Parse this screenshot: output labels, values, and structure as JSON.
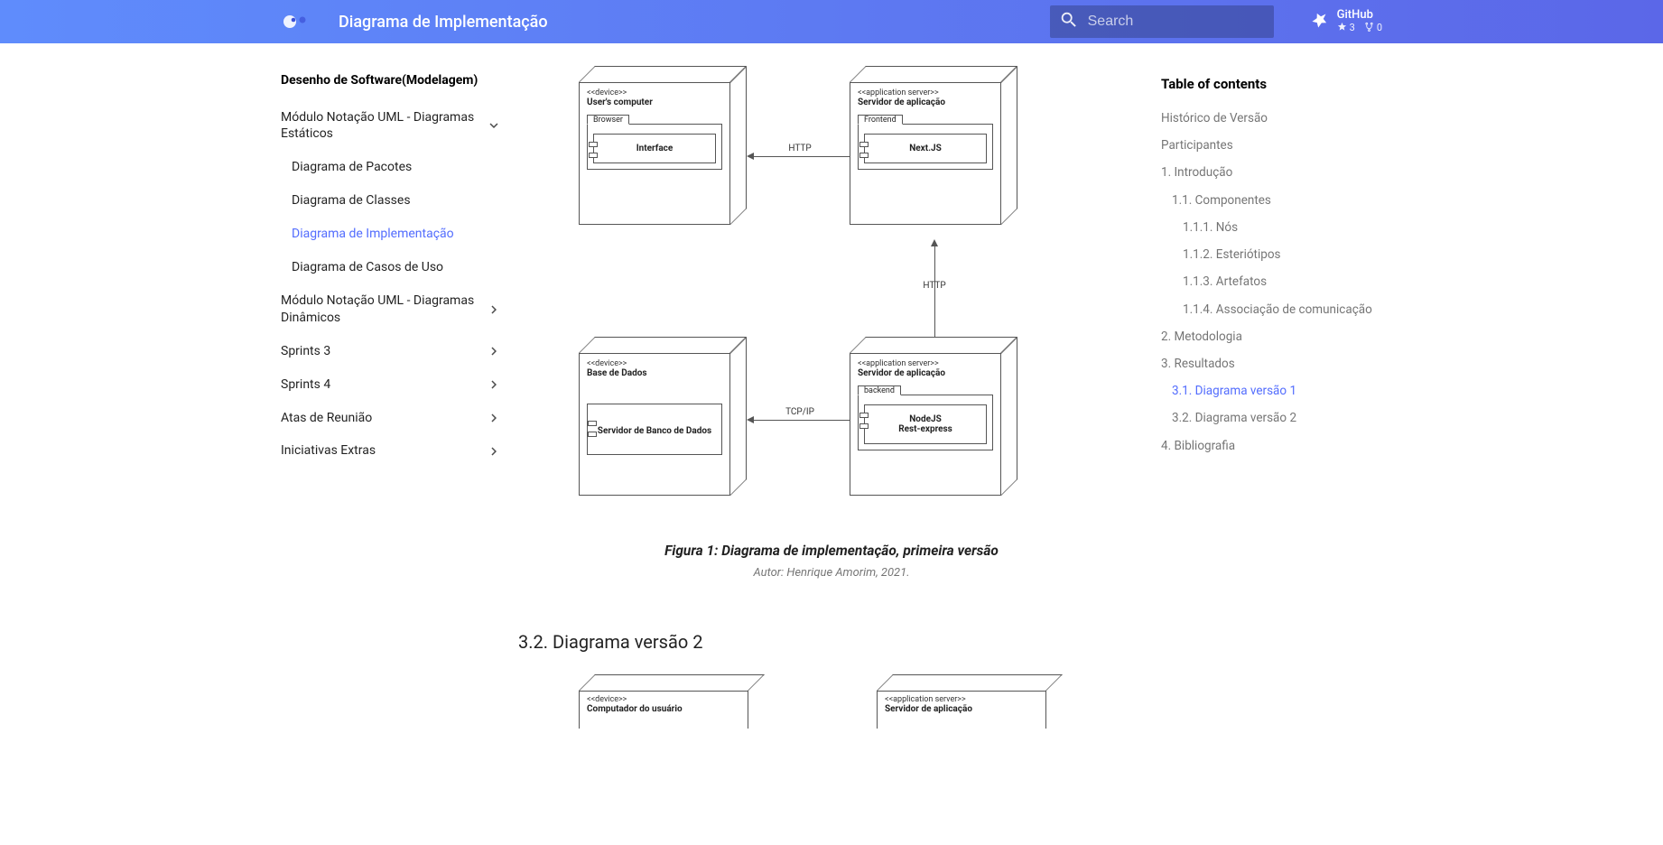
{
  "header": {
    "title": "Diagrama de Implementação",
    "search_placeholder": "Search",
    "github": {
      "name": "GitHub",
      "stars": "3",
      "forks": "0"
    }
  },
  "sidebar": {
    "active_section": "Desenho de Software(Modelagem)",
    "groups": [
      {
        "label": "Módulo Notação UML - Diagramas Estáticos",
        "expanded": true,
        "children": [
          {
            "label": "Diagrama de Pacotes",
            "active": false
          },
          {
            "label": "Diagrama de Classes",
            "active": false
          },
          {
            "label": "Diagrama de Implementação",
            "active": true
          },
          {
            "label": "Diagrama de Casos de Uso",
            "active": false
          }
        ]
      },
      {
        "label": "Módulo Notação UML - Diagramas Dinâmicos",
        "expanded": false
      },
      {
        "label": "Sprints 3",
        "expanded": false
      },
      {
        "label": "Sprints 4",
        "expanded": false
      },
      {
        "label": "Atas de Reunião",
        "expanded": false
      },
      {
        "label": "Iniciativas Extras",
        "expanded": false
      }
    ]
  },
  "diagram1": {
    "nodes": {
      "user_pc": {
        "stereo": "<<device>>",
        "name": "User's computer",
        "component_tab": "Browser",
        "component_inner": "Interface"
      },
      "app_front": {
        "stereo": "<<application server>>",
        "name": "Servidor de aplicação",
        "component_tab": "Frontend",
        "component_inner": "Next.JS"
      },
      "db": {
        "stereo": "<<device>>",
        "name": "Base de Dados",
        "component_inner": "Servidor de Banco de Dados"
      },
      "app_back": {
        "stereo": "<<application server>>",
        "name": "Servidor de aplicação",
        "component_tab": "backend",
        "component_inner_l1": "NodeJS",
        "component_inner_l2": "Rest-express"
      }
    },
    "arrows": {
      "http1": "HTTP",
      "http2": "HTTP",
      "tcpip": "TCP/IP"
    },
    "caption": "Figura 1: Diagrama de implementação, primeira versão",
    "author": "Autor: Henrique Amorim, 2021."
  },
  "section32_heading": "3.2. Diagrama versão 2",
  "diagram2": {
    "nodes": {
      "user_pc": {
        "stereo": "<<device>>",
        "name": "Computador do usuário"
      },
      "app": {
        "stereo": "<<application server>>",
        "name": "Servidor de aplicação"
      }
    }
  },
  "toc": {
    "title": "Table of contents",
    "items": [
      {
        "label": "Histórico de Versão",
        "level": 0
      },
      {
        "label": "Participantes",
        "level": 0
      },
      {
        "label": "1. Introdução",
        "level": 0
      },
      {
        "label": "1.1. Componentes",
        "level": 1
      },
      {
        "label": "1.1.1. Nós",
        "level": 2
      },
      {
        "label": "1.1.2. Esteriótipos",
        "level": 2
      },
      {
        "label": "1.1.3. Artefatos",
        "level": 2
      },
      {
        "label": "1.1.4. Associação de comunicação",
        "level": 2
      },
      {
        "label": "2. Metodologia",
        "level": 0
      },
      {
        "label": "3. Resultados",
        "level": 0
      },
      {
        "label": "3.1. Diagrama versão 1",
        "level": 1,
        "active": true
      },
      {
        "label": "3.2. Diagrama versão 2",
        "level": 1
      },
      {
        "label": "4. Bibliografia",
        "level": 0
      }
    ]
  }
}
